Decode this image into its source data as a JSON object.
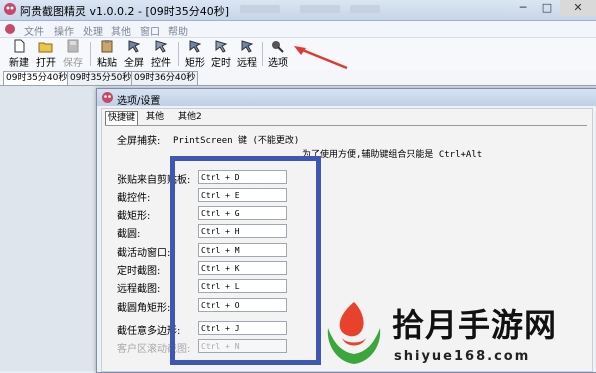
{
  "window": {
    "title": "阿贵截图精灵 v1.0.0.2 - [09时35分40秒]",
    "buttons": [
      "─",
      "□",
      "✕"
    ]
  },
  "menu": [
    "文件",
    "操作",
    "处理",
    "其他",
    "窗口",
    "帮助"
  ],
  "toolbar": [
    {
      "label": "新建",
      "icon": "new-doc-icon"
    },
    {
      "label": "打开",
      "icon": "open-folder-icon"
    },
    {
      "label": "保存",
      "icon": "save-icon",
      "disabled": true
    },
    {
      "label": "粘贴",
      "icon": "paste-icon"
    },
    {
      "label": "全屏",
      "icon": "fullscreen-capture-icon"
    },
    {
      "label": "控件",
      "icon": "control-capture-icon"
    },
    {
      "label": "矩形",
      "icon": "rect-capture-icon"
    },
    {
      "label": "定时",
      "icon": "timer-capture-icon"
    },
    {
      "label": "远程",
      "icon": "remote-capture-icon"
    },
    {
      "label": "选项",
      "icon": "options-icon"
    }
  ],
  "tabs": [
    "09时35分40秒",
    "09时35分50秒",
    "09时36分40秒"
  ],
  "dialog": {
    "title": "选项/设置",
    "tabs": [
      "快捷键",
      "其他",
      "其他2"
    ],
    "fullscreen_label": "全屏捕获:",
    "fullscreen_value": "PrintScreen 键 (不能更改)",
    "note": "为了使用方便,辅助键组合只能是 Ctrl+Alt",
    "rows": [
      {
        "label": "张贴来自剪贴板:",
        "value": "Ctrl + D"
      },
      {
        "label": "截控件:",
        "value": "Ctrl + E"
      },
      {
        "label": "截矩形:",
        "value": "Ctrl + G"
      },
      {
        "label": "截圆:",
        "value": "Ctrl + H"
      },
      {
        "label": "截活动窗口:",
        "value": "Ctrl + M"
      },
      {
        "label": "定时截图:",
        "value": "Ctrl + K"
      },
      {
        "label": "远程截图:",
        "value": "Ctrl + L"
      },
      {
        "label": "截圆角矩形:",
        "value": "Ctrl + O"
      },
      {
        "label": "截任意多边形:",
        "value": "Ctrl + J"
      },
      {
        "label": "客户区滚动截图:",
        "value": "Ctrl + N",
        "disabled": true
      }
    ]
  },
  "watermark": {
    "text": "拾月手游网",
    "url": "shiyue168.com"
  },
  "colors": {
    "highlight_box": "#3f57b3",
    "arrow": "#e03a2f",
    "logo_red": "#e8412c",
    "logo_green": "#3aa63c"
  }
}
